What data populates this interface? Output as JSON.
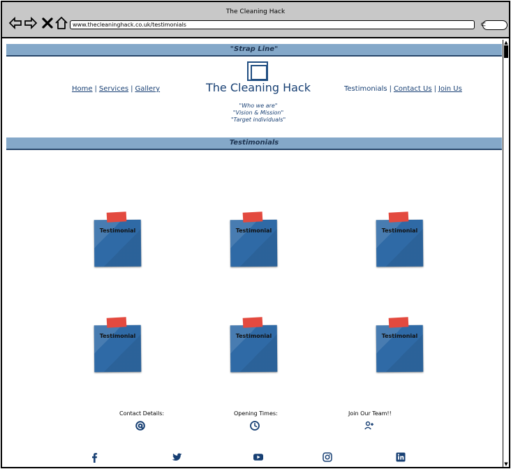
{
  "window": {
    "title": "The Cleaning Hack",
    "url": "www.thecleaninghack.co.uk/testimonials",
    "search_icon": "search-icon"
  },
  "page": {
    "strap_line": "\"Strap Line\"",
    "brand": "The Cleaning Hack",
    "menu_left": [
      "Home",
      "Services",
      "Gallery"
    ],
    "menu_right": [
      "Testimonials",
      "Contact Us",
      "Join Us"
    ],
    "mission": [
      "\"Who we are\"",
      "\"Vision & Mission\"",
      "\"Target individuals\""
    ],
    "section_title": "Testimonials"
  },
  "testimonials": [
    {
      "label": "Testimonial"
    },
    {
      "label": "Testimonial"
    },
    {
      "label": "Testimonial"
    },
    {
      "label": "Testimonial"
    },
    {
      "label": "Testimonial"
    },
    {
      "label": "Testimonial"
    }
  ],
  "footer": {
    "items": [
      {
        "label": "Contact Details:",
        "icon": "at-icon"
      },
      {
        "label": "Opening Times:",
        "icon": "clock-icon"
      },
      {
        "label": "Join Our Team!!",
        "icon": "add-user-icon"
      }
    ],
    "social": [
      "facebook-icon",
      "twitter-icon",
      "youtube-icon",
      "instagram-icon",
      "linkedin-icon"
    ]
  },
  "colors": {
    "band": "#84a8c9",
    "brand": "#173f73",
    "note": "#2f6aa6",
    "tape": "#e34a3f"
  }
}
